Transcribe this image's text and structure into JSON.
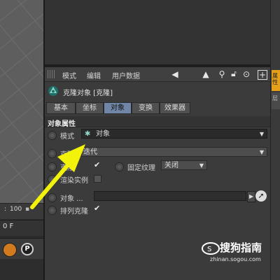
{
  "viewport": {},
  "coord_bar": {
    "sep": ":",
    "value": "100"
  },
  "timeline": {
    "frame": "0 F"
  },
  "attribute_manager": {
    "menu": [
      "模式",
      "编辑",
      "用户数据"
    ],
    "object_title": "克隆对象 [克隆]",
    "tabs": [
      "基本",
      "坐标",
      "对象",
      "变换",
      "效果器"
    ],
    "active_tab": "对象",
    "section_title": "对象属性",
    "fields": {
      "mode_label": "模式",
      "mode_value": "对象",
      "clone_label": "克隆",
      "clone_value": "迭代",
      "fix_clone_label": "克隆",
      "fix_texture_label": "固定纹理",
      "fix_texture_value": "关闭",
      "render_instance_label": "渲染实例",
      "object_label": "对象 ...",
      "arrange_clone_label": "排列克隆"
    }
  },
  "right_panel": {
    "tab1": "属性",
    "tab2": "层"
  },
  "watermark": {
    "brand": "搜狗指南",
    "url": "zhinan.sogou.com"
  },
  "icons": {
    "arrow_left": "arrow-left-icon",
    "arrow_up": "arrow-up-icon",
    "search": "search-icon",
    "lock": "lock-icon",
    "settings": "settings-icon",
    "add": "add-icon"
  },
  "colors": {
    "active_tab": "#6f86a6",
    "annotation_arrow": "#f2f20a",
    "right_tab": "#e5a01b"
  }
}
